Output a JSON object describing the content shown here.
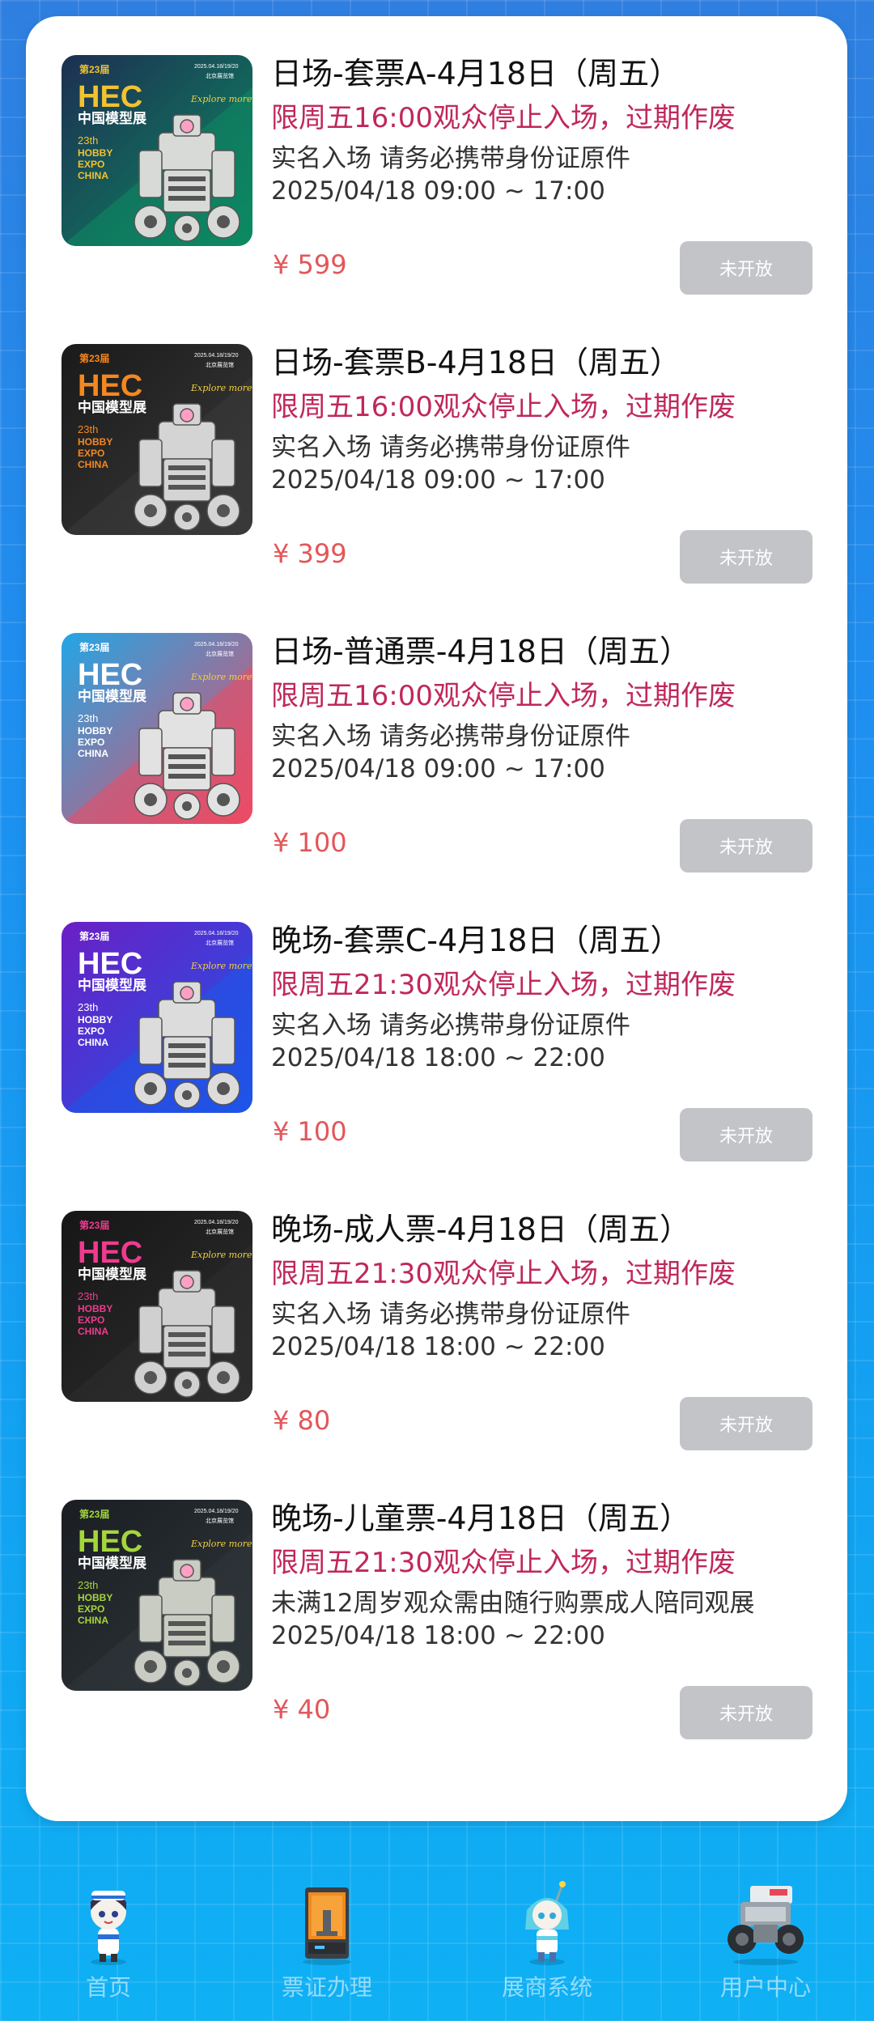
{
  "tickets": [
    {
      "title": "日场-套票A-4月18日（周五）",
      "warning": "限周五16:00观众停止入场，过期作废",
      "note": "实名入场 请务必携带身份证原件",
      "time": "2025/04/18 09:00 ~ 17:00",
      "price": "¥ 599",
      "button": "未开放",
      "poster": {
        "bg1": "#1d2f52",
        "bg2": "#0c8b62",
        "accent": "#f2c230",
        "robot": "#d8dad8",
        "badge": "第23届",
        "date": "2025.04.18/19/20",
        "venue": "北京展览馆",
        "logo": "HEC",
        "logo_cn": "中国模型展",
        "slogan": "Explore more"
      }
    },
    {
      "title": "日场-套票B-4月18日（周五）",
      "warning": "限周五16:00观众停止入场，过期作废",
      "note": "实名入场 请务必携带身份证原件",
      "time": "2025/04/18 09:00 ~ 17:00",
      "price": "¥ 399",
      "button": "未开放",
      "poster": {
        "bg1": "#1a1a1a",
        "bg2": "#3a3a3a",
        "accent": "#f5871f",
        "robot": "#d4d4d4",
        "badge": "第23届",
        "date": "2025.04.18/19/20",
        "venue": "北京展览馆",
        "logo": "HEC",
        "logo_cn": "中国模型展",
        "slogan": "Explore more"
      }
    },
    {
      "title": "日场-普通票-4月18日（周五）",
      "warning": "限周五16:00观众停止入场，过期作废",
      "note": "实名入场 请务必携带身份证原件",
      "time": "2025/04/18 09:00 ~ 17:00",
      "price": "¥ 100",
      "button": "未开放",
      "poster": {
        "bg1": "#22a6e6",
        "bg2": "#ee4a63",
        "accent": "#ffffff",
        "robot": "#e2e2e2",
        "badge": "第23届",
        "date": "2025.04.18/19/20",
        "venue": "北京展览馆",
        "logo": "HEC",
        "logo_cn": "中国模型展",
        "slogan": "Explore more"
      }
    },
    {
      "title": "晚场-套票C-4月18日（周五）",
      "warning": "限周五21:30观众停止入场，过期作废",
      "note": "实名入场 请务必携带身份证原件",
      "time": "2025/04/18 18:00 ~ 22:00",
      "price": "¥ 100",
      "button": "未开放",
      "poster": {
        "bg1": "#6b1fc4",
        "bg2": "#1d55e8",
        "accent": "#ffffff",
        "robot": "#dcdcdc",
        "badge": "第23届",
        "date": "2025.04.18/19/20",
        "venue": "北京展览馆",
        "logo": "HEC",
        "logo_cn": "中国模型展",
        "slogan": "Explore more"
      }
    },
    {
      "title": "晚场-成人票-4月18日（周五）",
      "warning": "限周五21:30观众停止入场，过期作废",
      "note": "实名入场 请务必携带身份证原件",
      "time": "2025/04/18 18:00 ~ 22:00",
      "price": "¥ 80",
      "button": "未开放",
      "poster": {
        "bg1": "#161616",
        "bg2": "#2e2e2e",
        "accent": "#ee3b8f",
        "robot": "#d0d0d0",
        "badge": "第23届",
        "date": "2025.04.18/19/20",
        "venue": "北京展览馆",
        "logo": "HEC",
        "logo_cn": "中国模型展",
        "slogan": "Explore more"
      }
    },
    {
      "title": "晚场-儿童票-4月18日（周五）",
      "warning": "限周五21:30观众停止入场，过期作废",
      "note": "未满12周岁观众需由随行购票成人陪同观展",
      "time": "2025/04/18 18:00 ~ 22:00",
      "price": "¥ 40",
      "button": "未开放",
      "poster": {
        "bg1": "#1a1e22",
        "bg2": "#30363b",
        "accent": "#a4d63c",
        "robot": "#c9ccc2",
        "badge": "第23届",
        "date": "2025.04.18/19/20",
        "venue": "北京展览馆",
        "logo": "HEC",
        "logo_cn": "中国模型展",
        "slogan": "Explore more"
      }
    }
  ],
  "tabbar": [
    {
      "label": "首页",
      "icon": "mascot-girl-icon"
    },
    {
      "label": "票证办理",
      "icon": "printer-icon"
    },
    {
      "label": "展商系统",
      "icon": "mascot-robot-icon"
    },
    {
      "label": "用户中心",
      "icon": "mech-vehicle-icon"
    }
  ]
}
